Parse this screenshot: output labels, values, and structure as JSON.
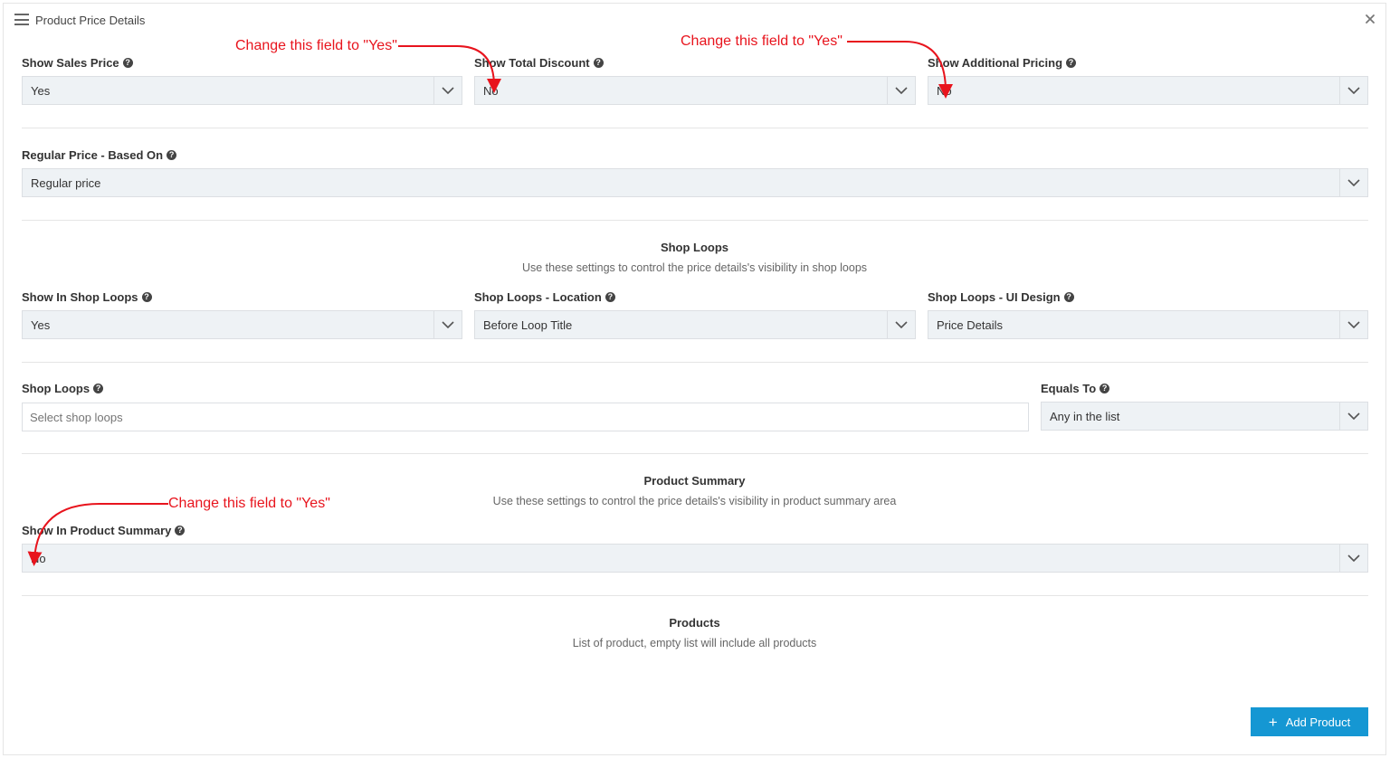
{
  "header": {
    "title": "Product Price Details",
    "menu_icon": "hamburger-menu-icon",
    "close_icon": "close-icon"
  },
  "fields": {
    "show_sales_price": {
      "label": "Show Sales Price",
      "value": "Yes"
    },
    "show_total_discount": {
      "label": "Show Total Discount",
      "value": "No"
    },
    "show_additional_pricing": {
      "label": "Show Additional Pricing",
      "value": "No"
    },
    "regular_price_based_on": {
      "label": "Regular Price - Based On",
      "value": "Regular price"
    },
    "show_in_shop_loops": {
      "label": "Show In Shop Loops",
      "value": "Yes"
    },
    "shop_loops_location": {
      "label": "Shop Loops - Location",
      "value": "Before Loop Title"
    },
    "shop_loops_ui_design": {
      "label": "Shop Loops - UI Design",
      "value": "Price Details"
    },
    "shop_loops": {
      "label": "Shop Loops",
      "placeholder": "Select shop loops"
    },
    "equals_to": {
      "label": "Equals To",
      "value": "Any in the list"
    },
    "show_in_product_summary": {
      "label": "Show In Product Summary",
      "value": "No"
    }
  },
  "sections": {
    "shop_loops": {
      "title": "Shop Loops",
      "description": "Use these settings to control the price details's visibility in shop loops"
    },
    "product_summary": {
      "title": "Product Summary",
      "description": "Use these settings to control the price details's visibility in product summary area"
    },
    "products": {
      "title": "Products",
      "description": "List of product, empty list will include all products"
    }
  },
  "buttons": {
    "add_product": {
      "label": "Add Product",
      "icon": "plus-icon"
    }
  },
  "annotations": [
    "Change this field to \"Yes\"",
    "Change this field to \"Yes\"",
    "Change this field to \"Yes\""
  ],
  "colors": {
    "accent": "#1597d3",
    "select_bg": "#eef2f5",
    "annotation": "#e8141d"
  }
}
